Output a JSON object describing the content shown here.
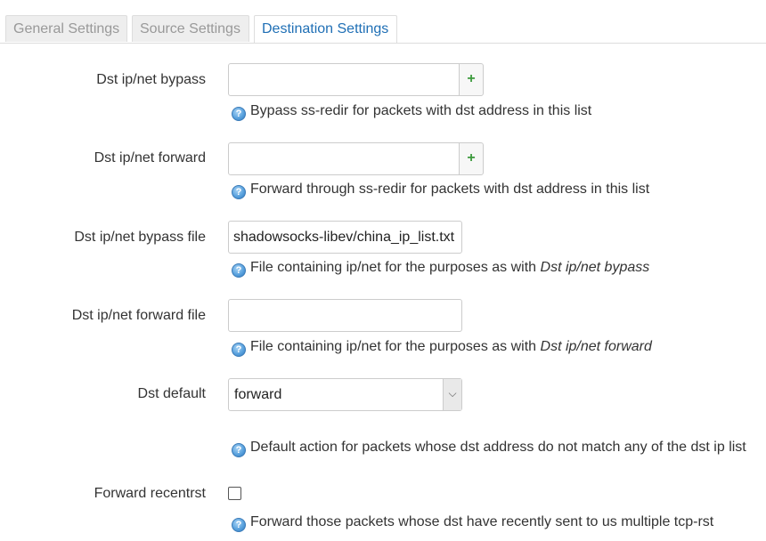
{
  "tabs": [
    {
      "label": "General Settings",
      "active": false
    },
    {
      "label": "Source Settings",
      "active": false
    },
    {
      "label": "Destination Settings",
      "active": true
    }
  ],
  "fields": {
    "dst_bypass": {
      "label": "Dst ip/net bypass",
      "value": "",
      "add_label": "+",
      "help": "Bypass ss-redir for packets with dst address in this list"
    },
    "dst_forward": {
      "label": "Dst ip/net forward",
      "value": "",
      "add_label": "+",
      "help": "Forward through ss-redir for packets with dst address in this list"
    },
    "dst_bypass_file": {
      "label": "Dst ip/net bypass file",
      "value": "shadowsocks-libev/china_ip_list.txt",
      "help_prefix": "File containing ip/net for the purposes as with ",
      "help_ref": "Dst ip/net bypass"
    },
    "dst_forward_file": {
      "label": "Dst ip/net forward file",
      "value": "",
      "help_prefix": "File containing ip/net for the purposes as with ",
      "help_ref": "Dst ip/net forward"
    },
    "dst_default": {
      "label": "Dst default",
      "selected": "forward",
      "help": "Default action for packets whose dst address do not match any of the dst ip list"
    },
    "forward_recentrst": {
      "label": "Forward recentrst",
      "checked": false,
      "help": "Forward those packets whose dst have recently sent to us multiple tcp-rst"
    }
  },
  "icons": {
    "help": "help-icon",
    "add": "plus-icon",
    "dropdown": "chevron-down-icon"
  },
  "colors": {
    "active_tab_text": "#1f6fb5",
    "inactive_tab_text": "#999999",
    "add_button": "#3c9a3c",
    "help_icon": "#5aa2de"
  }
}
